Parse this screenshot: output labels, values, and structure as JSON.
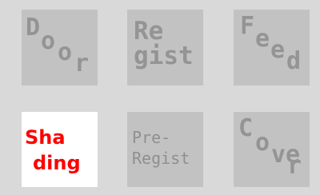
{
  "buttons": {
    "door": {
      "chars": [
        "D",
        "o",
        "o",
        "r"
      ],
      "state": "disabled"
    },
    "regist": {
      "lines": [
        "Re",
        "gist"
      ],
      "state": "disabled"
    },
    "feed": {
      "chars": [
        "F",
        "e",
        "e",
        "d"
      ],
      "state": "disabled"
    },
    "shading": {
      "lines": [
        "Sha",
        "ding"
      ],
      "state": "active"
    },
    "pre_regist": {
      "lines": [
        "Pre-",
        "Regist"
      ],
      "state": "disabled"
    },
    "cover": {
      "chars": [
        "C",
        "o",
        "v",
        "e",
        "r"
      ],
      "state": "disabled"
    }
  },
  "colors": {
    "background": "#d9d9d9",
    "tile_disabled": "#c2c2c2",
    "text_disabled": "#949494",
    "tile_active": "#ffffff",
    "text_active": "#ff0000"
  }
}
